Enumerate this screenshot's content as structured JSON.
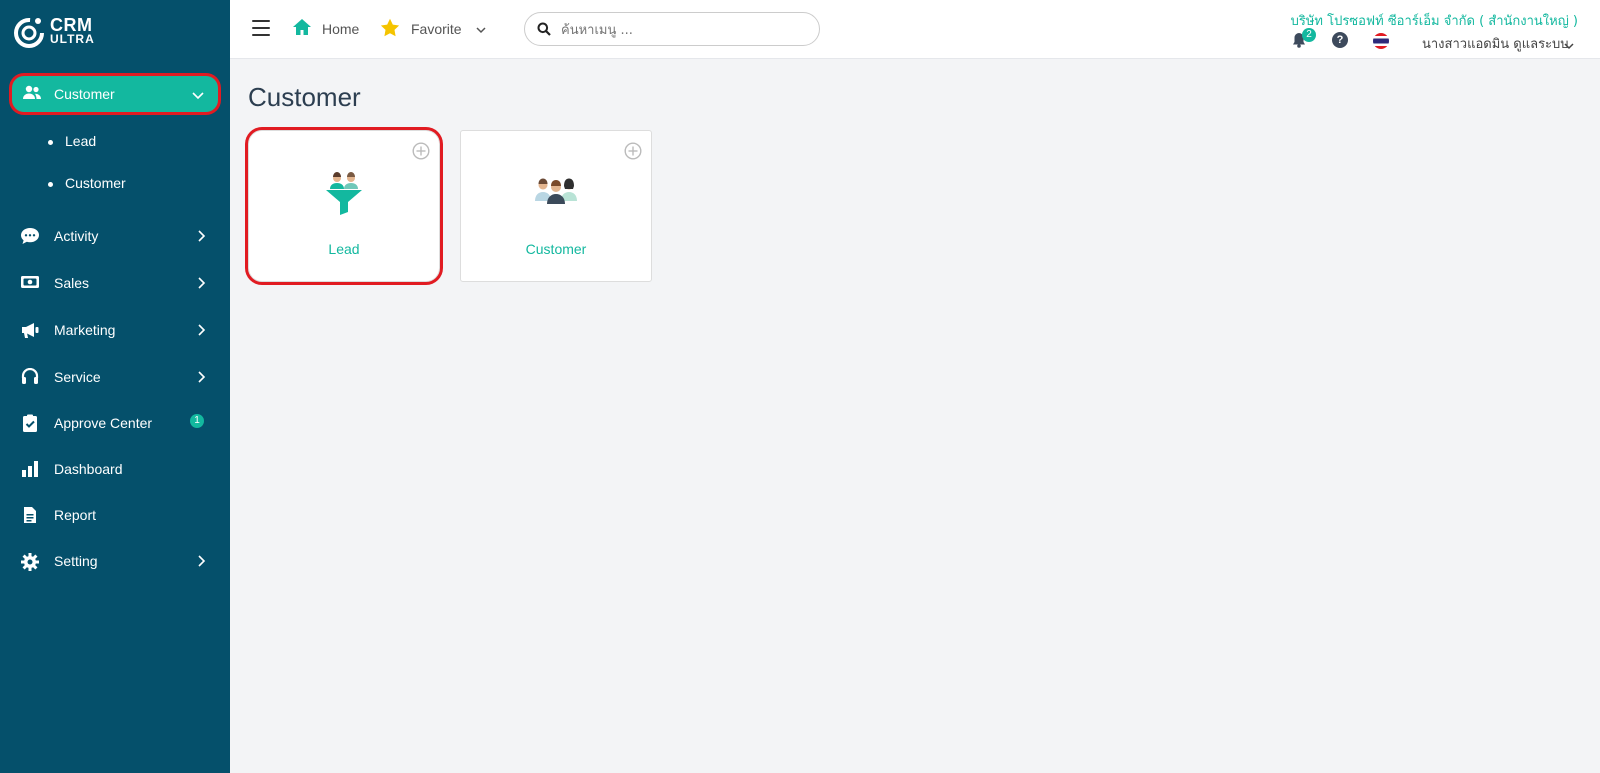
{
  "brand": {
    "line1": "CRM",
    "line2": "ULTRA"
  },
  "sidebar": {
    "active": {
      "label": "Customer",
      "icon": "users-icon"
    },
    "submenu": [
      "Lead",
      "Customer"
    ],
    "items": [
      {
        "label": "Activity",
        "icon": "chat-icon",
        "has_children": true
      },
      {
        "label": "Sales",
        "icon": "cash-icon",
        "has_children": true
      },
      {
        "label": "Marketing",
        "icon": "megaphone-icon",
        "has_children": true
      },
      {
        "label": "Service",
        "icon": "headset-icon",
        "has_children": true
      },
      {
        "label": "Approve Center",
        "icon": "clipboard-check-icon",
        "badge": "1"
      },
      {
        "label": "Dashboard",
        "icon": "bar-chart-icon"
      },
      {
        "label": "Report",
        "icon": "document-icon"
      },
      {
        "label": "Setting",
        "icon": "gear-icon",
        "has_children": true
      }
    ]
  },
  "topbar": {
    "home_label": "Home",
    "favorite_label": "Favorite",
    "search_placeholder": "ค้นหาเมนู ...",
    "company": "บริษัท โปรซอฟท์ ซีอาร์เอ็ม จำกัด ( สำนักงานใหญ่ )",
    "notification_count": "2",
    "help_label": "?",
    "user_name": "นางสาวแอดมิน ดูแลระบบ"
  },
  "main": {
    "title": "Customer",
    "tiles": [
      {
        "label": "Lead",
        "icon": "lead-funnel-icon"
      },
      {
        "label": "Customer",
        "icon": "customer-group-icon"
      }
    ]
  },
  "colors": {
    "sidebar": "#05506b",
    "accent": "#13b89f",
    "highlight": "#e11b22"
  }
}
